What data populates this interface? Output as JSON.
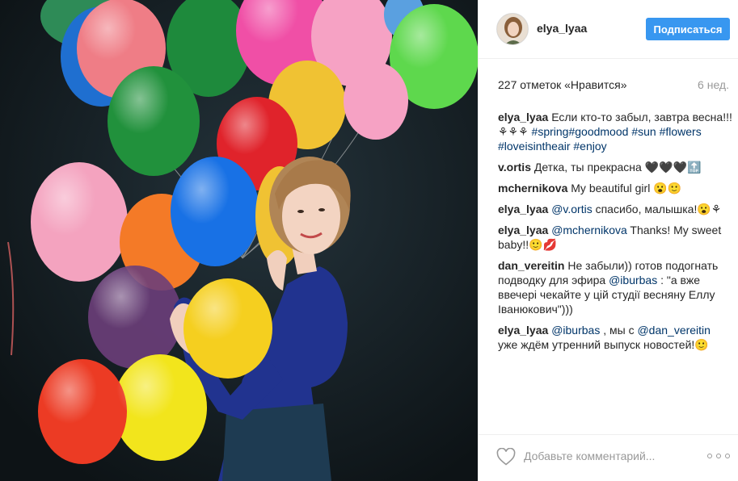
{
  "post": {
    "image_alt": "Woman holding balloons"
  },
  "header": {
    "username": "elya_lyaa",
    "follow_label": "Подписаться"
  },
  "stats": {
    "likes": "227 отметок «Нравится»",
    "age": "6 нед."
  },
  "comments": [
    {
      "author": "elya_lyaa",
      "parts": [
        {
          "t": "text",
          "v": "Если кто-то забыл, завтра весна!!! ⚘⚘⚘ "
        },
        {
          "t": "tag",
          "v": "#spring"
        },
        {
          "t": "tag",
          "v": "#goodmood"
        },
        {
          "t": "text",
          "v": " "
        },
        {
          "t": "tag",
          "v": "#sun"
        },
        {
          "t": "text",
          "v": " "
        },
        {
          "t": "tag",
          "v": "#flowers"
        },
        {
          "t": "text",
          "v": " "
        },
        {
          "t": "tag",
          "v": "#loveisintheair"
        },
        {
          "t": "text",
          "v": " "
        },
        {
          "t": "tag",
          "v": "#enjoy"
        }
      ]
    },
    {
      "author": "v.ortis",
      "parts": [
        {
          "t": "text",
          "v": "Детка, ты прекрасна 🖤🖤🖤🔝"
        }
      ]
    },
    {
      "author": "mchernikova",
      "parts": [
        {
          "t": "text",
          "v": "My beautiful girl 😮🙂"
        }
      ]
    },
    {
      "author": "elya_lyaa",
      "parts": [
        {
          "t": "tag",
          "v": "@v.ortis"
        },
        {
          "t": "text",
          "v": " спасибо, малышка!😮⚘"
        }
      ]
    },
    {
      "author": "elya_lyaa",
      "parts": [
        {
          "t": "tag",
          "v": "@mchernikova"
        },
        {
          "t": "text",
          "v": " Thanks! My sweet baby!!🙂💋"
        }
      ]
    },
    {
      "author": "dan_vereitin",
      "parts": [
        {
          "t": "text",
          "v": "Не забыли)) готов подогнать подводку для эфира "
        },
        {
          "t": "tag",
          "v": "@iburbas"
        },
        {
          "t": "text",
          "v": " : \"а вже ввечері чекайте у цій студії весняну Еллу Іванюкович\")))"
        }
      ]
    },
    {
      "author": "elya_lyaa",
      "parts": [
        {
          "t": "tag",
          "v": "@iburbas"
        },
        {
          "t": "text",
          "v": " , мы с "
        },
        {
          "t": "tag",
          "v": "@dan_vereitin"
        },
        {
          "t": "text",
          "v": " уже ждём утренний выпуск новостей!🙂"
        }
      ]
    }
  ],
  "footer": {
    "comment_placeholder": "Добавьте комментарий...",
    "like_icon": "heart-outline-icon",
    "more_icon": "more-options-icon"
  },
  "colors": {
    "accent": "#3897f0",
    "hashtag": "#003569",
    "muted": "#999999",
    "border": "#efefef"
  }
}
